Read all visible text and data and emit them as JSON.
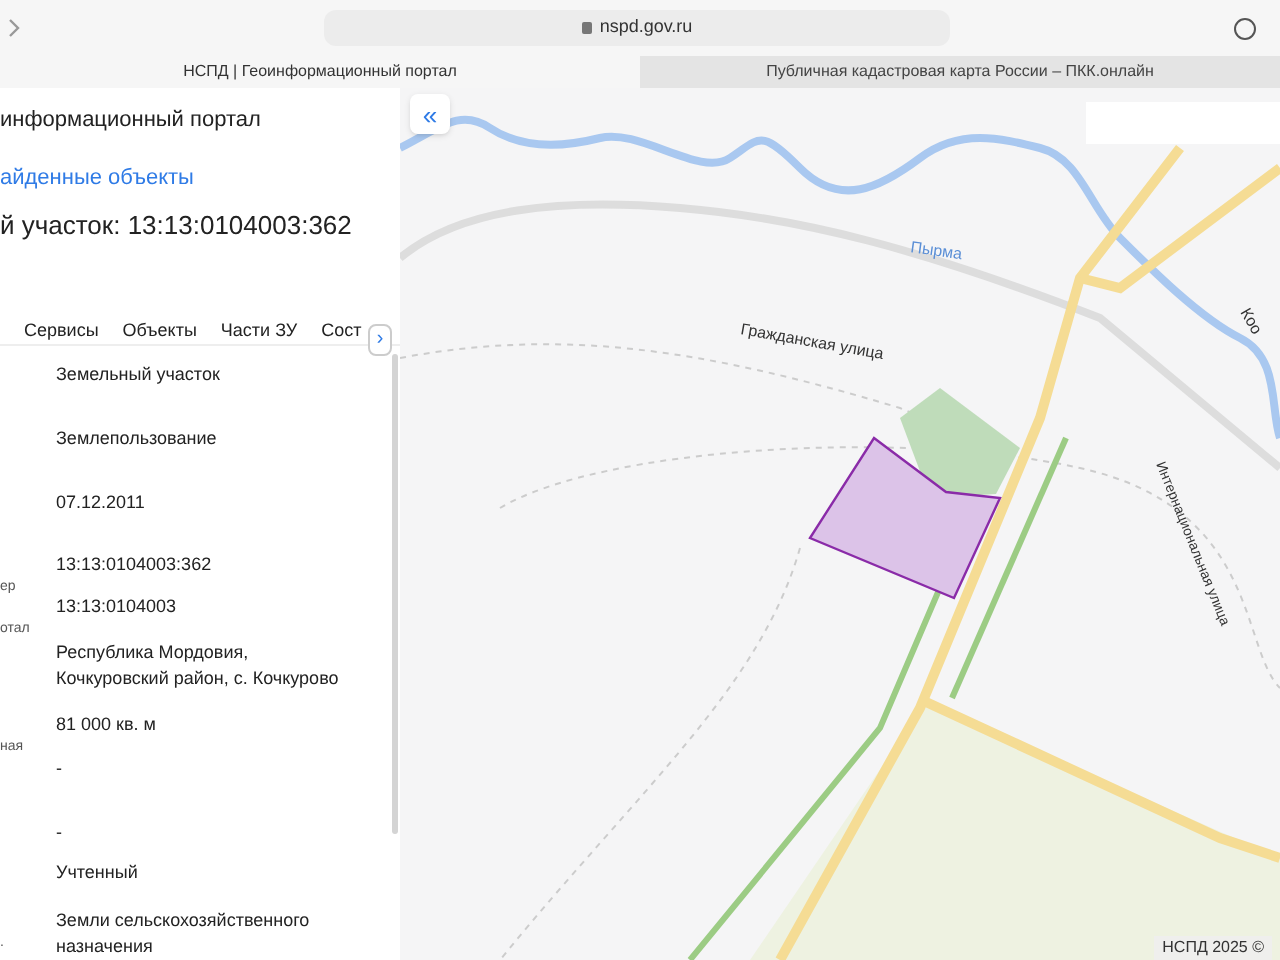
{
  "browser": {
    "url": "nspd.gov.ru",
    "tabs": [
      {
        "title": "НСПД | Геоинформационный портал",
        "selected": true
      },
      {
        "title": "Публичная кадастровая карта России – ПКК.онлайн",
        "selected": false
      }
    ]
  },
  "panel": {
    "portal_title": "информационный портал",
    "back_link": "айденные объекты",
    "object_title": "й участок: 13:13:0104003:362",
    "tabs": [
      {
        "label": "Сервисы",
        "selected": false
      },
      {
        "label": "Объекты",
        "selected": false
      },
      {
        "label": "Части ЗУ",
        "selected": false
      },
      {
        "label": "Сост",
        "selected": false
      }
    ],
    "tab_scroll": "›",
    "rows": [
      {
        "value": "Земельный участок"
      },
      {
        "value": "Землепользование"
      },
      {
        "value": "07.12.2011"
      },
      {
        "label": "ер",
        "value": "13:13:0104003:362"
      },
      {
        "label": "отал",
        "value": "13:13:0104003"
      },
      {
        "value": "Республика Мордовия, Кочкуровский район, с. Кочкурово"
      },
      {
        "label": "ная",
        "value": "81 000 кв. м"
      },
      {
        "value": "-"
      },
      {
        "value": "-"
      },
      {
        "value": "Учтенный"
      },
      {
        "label": ".",
        "value": "Земли сельскохозяйственного назначения"
      }
    ]
  },
  "map": {
    "collapse_button": "«",
    "labels": [
      {
        "text": "Пырма",
        "kind": "river"
      },
      {
        "text": "Гражданская улица",
        "kind": "street"
      },
      {
        "text": "Интернациональная улица",
        "kind": "street-vertical"
      },
      {
        "text": "Коо",
        "kind": "street-edge"
      }
    ],
    "attribution": "НСПД 2025 ©"
  }
}
